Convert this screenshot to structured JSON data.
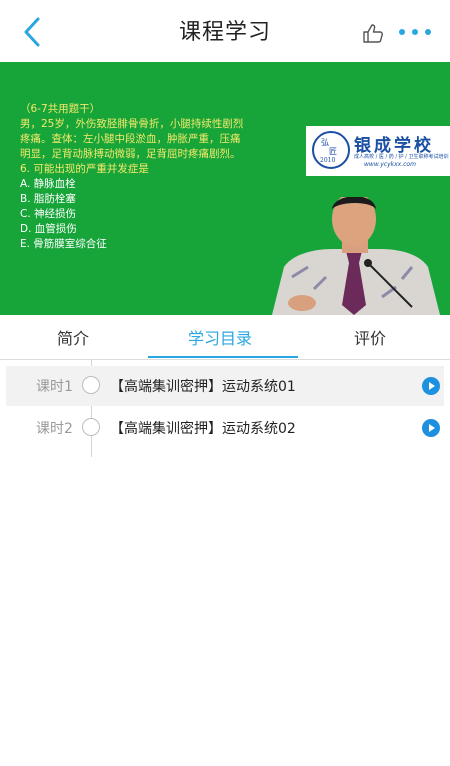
{
  "header": {
    "title": "课程学习",
    "back_icon": "chevron-left-icon",
    "like_icon": "thumbs-up-icon",
    "more_icon": "more-dots-icon",
    "accent": "#29a7e1"
  },
  "video": {
    "background": "#17a53a",
    "question_lines": [
      "（6-7共用题干）",
      "男，25岁，外伤致胫腓骨骨折，小腿持续性剧烈",
      "疼痛。查体：左小腿中段淤血，肿胀严重，压痛",
      "明显，足背动脉搏动微弱，足背屈时疼痛剧烈。",
      "6. 可能出现的严重并发症是"
    ],
    "options": [
      "A. 静脉血栓",
      "B. 脂肪栓塞",
      "C. 神经损伤",
      "D. 血管损伤",
      "E. 骨筋膜室综合征"
    ],
    "logo": {
      "seal_char_1": "弘",
      "seal_char_2": "匠",
      "seal_year": "2010",
      "name": "银成学校",
      "subtitle": "成人高校 / 医 / 药 / 护 / 卫生职称考试培训",
      "url": "www.ycykxx.com"
    }
  },
  "tabs": [
    {
      "label": "简介",
      "active": false
    },
    {
      "label": "学习目录",
      "active": true
    },
    {
      "label": "评价",
      "active": false
    }
  ],
  "lessons": [
    {
      "period": "课时1",
      "title": "【高端集训密押】运动系统01",
      "selected": true
    },
    {
      "period": "课时2",
      "title": "【高端集训密押】运动系统02",
      "selected": false
    }
  ]
}
